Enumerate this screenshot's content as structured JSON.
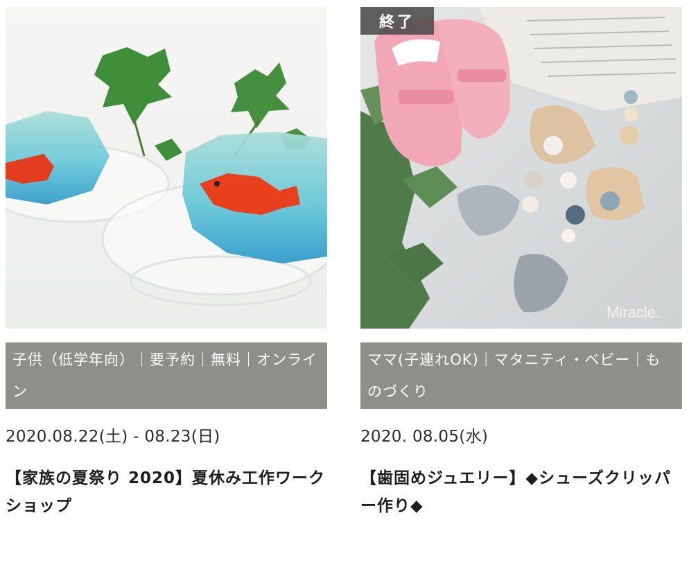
{
  "cards": [
    {
      "categories": "子供（低学年向）｜要予約｜無料｜オンライン",
      "date": "2020.08.22(土) - 08.23(日)",
      "title": "【家族の夏祭り 2020】夏休み工作ワークショップ",
      "image_alt": "金魚のゼリーとアイビーの葉"
    },
    {
      "badge": "終了",
      "categories": "ママ(子連れOK)｜マタニティ・ベビー｜ものづくり",
      "date": "2020. 08.05(水)",
      "title": "【歯固めジュエリー】◆シューズクリッパー作り◆",
      "image_alt": "ピンクのベビーシューズと木製の歯固めクリップ",
      "watermark": "Miracle."
    }
  ],
  "colors": {
    "category_band": "#8f8f8a",
    "badge_bg": "#464646",
    "text": "#222222"
  }
}
